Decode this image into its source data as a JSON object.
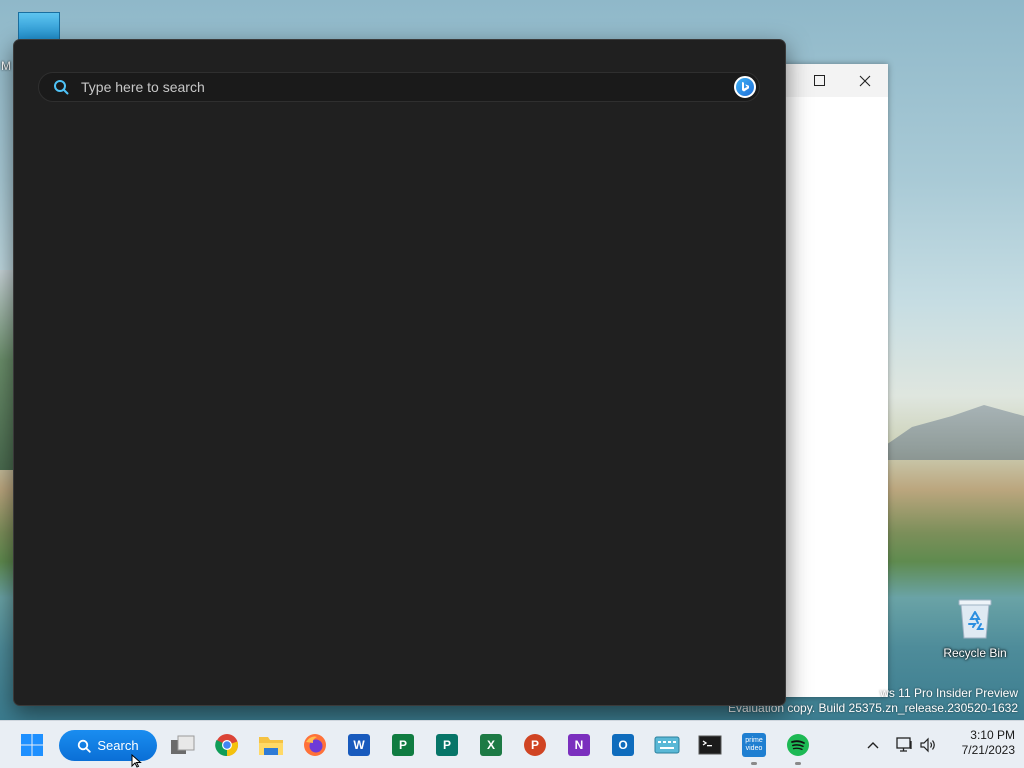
{
  "search_flyout": {
    "placeholder": "Type here to search",
    "bing_button": "bing-icon"
  },
  "background_window": {
    "controls": [
      "maximize-icon",
      "close-icon"
    ]
  },
  "desktop": {
    "partial_icon_letter": "M",
    "recycle_bin_label": "Recycle Bin",
    "watermark_line1": "ws 11 Pro Insider Preview",
    "watermark_line2": "Evaluation copy. Build 25375.zn_release.230520-1632"
  },
  "taskbar": {
    "search_label": "Search",
    "apps": [
      {
        "icon": "task-view-icon"
      },
      {
        "icon": "chrome-icon"
      },
      {
        "icon": "file-explorer-icon"
      },
      {
        "icon": "firefox-icon"
      },
      {
        "icon": "word-icon",
        "letter": "W"
      },
      {
        "icon": "project-icon",
        "letter": "P"
      },
      {
        "icon": "publisher-icon",
        "letter": "P"
      },
      {
        "icon": "excel-icon",
        "letter": "X"
      },
      {
        "icon": "powerpoint-icon",
        "letter": "P"
      },
      {
        "icon": "onenote-icon",
        "letter": "N"
      },
      {
        "icon": "outlook-icon",
        "letter": "O"
      },
      {
        "icon": "touch-keyboard-icon"
      },
      {
        "icon": "terminal-icon"
      },
      {
        "icon": "prime-video-icon",
        "label": "prime video"
      },
      {
        "icon": "spotify-icon"
      }
    ],
    "time": "3:10 PM",
    "date": "7/21/2023"
  },
  "colors": {
    "flyout_bg": "#202020",
    "accent": "#0a6fd6",
    "taskbar_bg": "#e9eef4"
  }
}
